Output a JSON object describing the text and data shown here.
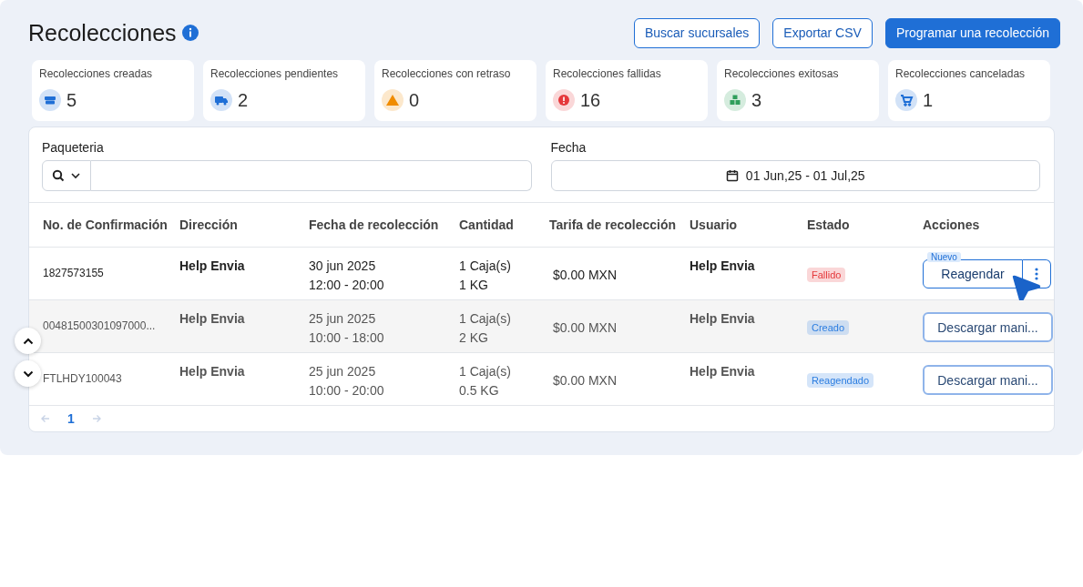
{
  "header": {
    "title": "Recolecciones",
    "buttons": [
      {
        "label": "Buscar sucursales",
        "kind": "outline"
      },
      {
        "label": "Exportar CSV",
        "kind": "outline"
      },
      {
        "label": "Programar una recolección",
        "kind": "primary"
      }
    ]
  },
  "stats": [
    {
      "label": "Recolecciones creadas",
      "value": "5",
      "kind": "boxes",
      "color": "#1f6fd6"
    },
    {
      "label": "Recolecciones pendientes",
      "value": "2",
      "kind": "truck",
      "color": "#1f6fd6"
    },
    {
      "label": "Recolecciones con retraso",
      "value": "0",
      "kind": "warning",
      "color": "#f08c00"
    },
    {
      "label": "Recolecciones fallidas",
      "value": "16",
      "kind": "error",
      "color": "#e5383b"
    },
    {
      "label": "Recolecciones exitosas",
      "value": "3",
      "kind": "stack",
      "color": "#2f9e5b"
    },
    {
      "label": "Recolecciones canceladas",
      "value": "1",
      "kind": "cart",
      "color": "#1f6fd6"
    }
  ],
  "filters": {
    "carrier_label": "Paqueteria",
    "date_label": "Fecha",
    "date_value": "01 Jun,25 - 01 Jul,25"
  },
  "table": {
    "columns": [
      "No. de Confirmación",
      "Dirección",
      "Fecha de recolección",
      "Cantidad",
      "Tarifa de recolección",
      "Usuario",
      "Estado",
      "Acciones"
    ],
    "rows": [
      {
        "confirmation": "1827573155",
        "address": "Help Envia",
        "date": "30 jun 2025",
        "time": "12:00 - 20:00",
        "boxes": "1 Caja(s)",
        "weight": "1 KG",
        "rate": "$0.00 MXN",
        "user": "Help Envia",
        "status": "Fallido",
        "color": "#e5383b",
        "dimmed": false,
        "action": {
          "kind": "split",
          "label": "Reagendar",
          "badge": "Nuevo"
        }
      },
      {
        "confirmation": "00481500301097000...",
        "address": "Help Envia",
        "date": "25 jun 2025",
        "time": "10:00 - 18:00",
        "boxes": "1 Caja(s)",
        "weight": "2 KG",
        "rate": "$0.00 MXN",
        "user": "Help Envia",
        "status": "Creado",
        "color": "#2b7de0",
        "dimmed": true,
        "action": {
          "kind": "plain",
          "label": "Descargar mani..."
        }
      },
      {
        "confirmation": "FTLHDY100043",
        "address": "Help Envia",
        "date": "25 jun 2025",
        "time": "10:00 - 20:00",
        "boxes": "1 Caja(s)",
        "weight": "0.5 KG",
        "rate": "$0.00 MXN",
        "user": "Help Envia",
        "status": "Reagendado",
        "color": "#2b7de0",
        "dimmed": true,
        "action": {
          "kind": "plain",
          "label": "Descargar mani..."
        }
      }
    ]
  },
  "pagination": {
    "pages": [
      {
        "label": "1",
        "selected": true
      }
    ],
    "prev_disabled": true,
    "next_disabled": true
  }
}
